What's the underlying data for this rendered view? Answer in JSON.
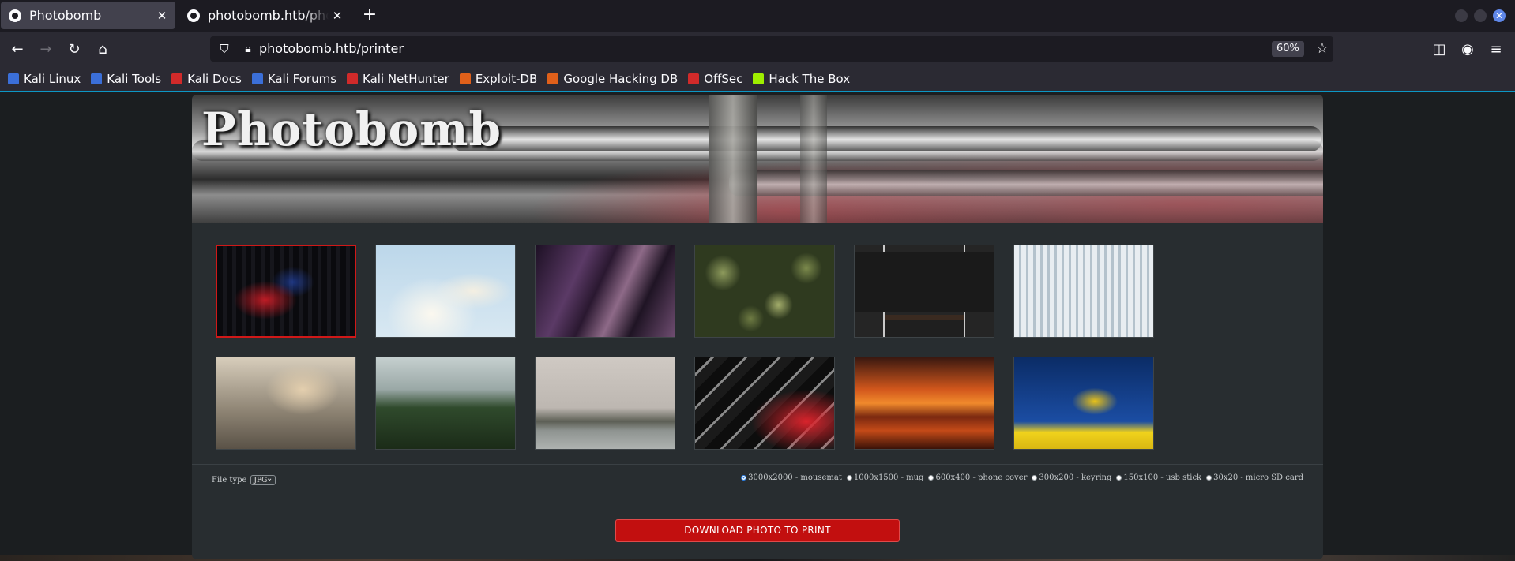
{
  "browser": {
    "tabs": [
      {
        "title": "Photobomb",
        "active": true
      },
      {
        "title": "photobomb.htb/photobomb",
        "active": false
      }
    ],
    "new_tab_icon": "plus-icon",
    "url": "photobomb.htb/printer",
    "zoom": "60%",
    "bookmarks": [
      {
        "label": "Kali Linux",
        "color": "#3b6fd8"
      },
      {
        "label": "Kali Tools",
        "color": "#3b6fd8"
      },
      {
        "label": "Kali Docs",
        "color": "#d12a2a"
      },
      {
        "label": "Kali Forums",
        "color": "#3b6fd8"
      },
      {
        "label": "Kali NetHunter",
        "color": "#d12a2a"
      },
      {
        "label": "Exploit-DB",
        "color": "#e0601a"
      },
      {
        "label": "Google Hacking DB",
        "color": "#e0601a"
      },
      {
        "label": "OffSec",
        "color": "#d12a2a"
      },
      {
        "label": "Hack The Box",
        "color": "#9fef00"
      }
    ]
  },
  "page": {
    "title": "Photobomb",
    "accent_color": "#c20f0f",
    "file_type_label": "File type",
    "file_type_value": "JPG",
    "sizes": [
      {
        "label": "3000x2000 - mousemat",
        "selected": true
      },
      {
        "label": "1000x1500 - mug",
        "selected": false
      },
      {
        "label": "600x400 - phone cover",
        "selected": false
      },
      {
        "label": "300x200 - keyring",
        "selected": false
      },
      {
        "label": "150x100 - usb stick",
        "selected": false
      },
      {
        "label": "30x20 - micro SD card",
        "selected": false
      }
    ],
    "download_label": "DOWNLOAD PHOTO TO PRINT",
    "photos": [
      {
        "name": "photo-red-light-streaks",
        "selected": true
      },
      {
        "name": "photo-white-blossom",
        "selected": false
      },
      {
        "name": "photo-skyscrapers-night",
        "selected": false
      },
      {
        "name": "photo-green-succulents",
        "selected": false
      },
      {
        "name": "photo-computer-desk",
        "selected": false
      },
      {
        "name": "photo-frozen-waterfall",
        "selected": false
      },
      {
        "name": "photo-woodworking-guitar",
        "selected": false
      },
      {
        "name": "photo-greenhouse",
        "selected": false
      },
      {
        "name": "photo-foggy-coast",
        "selected": false
      },
      {
        "name": "photo-chrome-red-abstract",
        "selected": false
      },
      {
        "name": "photo-boat-sunset",
        "selected": false
      },
      {
        "name": "photo-yellow-tree-blue-sky",
        "selected": false
      }
    ]
  }
}
